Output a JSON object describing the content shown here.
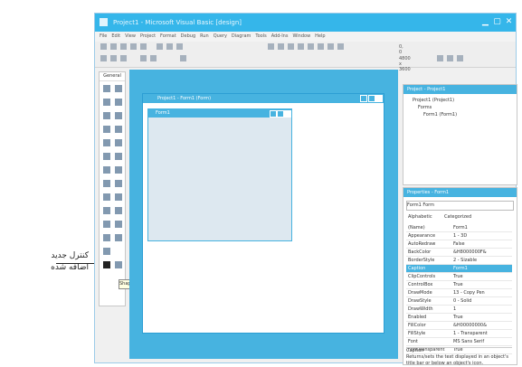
{
  "annotation": {
    "label_line1": "کنترل جدید",
    "label_line2": "اضافه شده"
  },
  "window": {
    "title": "Project1 - Microsoft Visual Basic [design]"
  },
  "menu": [
    "File",
    "Edit",
    "View",
    "Project",
    "Format",
    "Debug",
    "Run",
    "Query",
    "Diagram",
    "Tools",
    "Add-Ins",
    "Window",
    "Help"
  ],
  "toolbar": {
    "position": "0, 0",
    "size": "4800 x 3600"
  },
  "toolbox": {
    "title": "General",
    "tooltip": "Shape"
  },
  "child_window": {
    "title": "Project1 - Form1 (Form)"
  },
  "form": {
    "title": "Form1"
  },
  "solution": {
    "title": "Project - Project1",
    "items": [
      "Project1 (Project1)",
      "Forms",
      "Form1 (Form1)"
    ]
  },
  "properties": {
    "title": "Properties - Form1",
    "selector": "Form1 Form",
    "tabs": [
      "Alphabetic",
      "Categorized"
    ],
    "rows": [
      {
        "name": "(Name)",
        "value": "Form1"
      },
      {
        "name": "Appearance",
        "value": "1 - 3D"
      },
      {
        "name": "AutoRedraw",
        "value": "False"
      },
      {
        "name": "BackColor",
        "value": "&H8000000F&"
      },
      {
        "name": "BorderStyle",
        "value": "2 - Sizable"
      },
      {
        "name": "Caption",
        "value": "Form1"
      },
      {
        "name": "ClipControls",
        "value": "True"
      },
      {
        "name": "ControlBox",
        "value": "True"
      },
      {
        "name": "DrawMode",
        "value": "13 - Copy Pen"
      },
      {
        "name": "DrawStyle",
        "value": "0 - Solid"
      },
      {
        "name": "DrawWidth",
        "value": "1"
      },
      {
        "name": "Enabled",
        "value": "True"
      },
      {
        "name": "FillColor",
        "value": "&H00000000&"
      },
      {
        "name": "FillStyle",
        "value": "1 - Transparent"
      },
      {
        "name": "Font",
        "value": "MS Sans Serif"
      },
      {
        "name": "FontTransparent",
        "value": "True"
      }
    ],
    "selected_index": 5,
    "desc_title": "Caption",
    "desc_text": "Returns/sets the text displayed in an object's title bar or below an object's icon."
  },
  "colors": {
    "accent": "#35b6ea",
    "workspace": "#47b3e0",
    "form_bg": "#dde8f0"
  }
}
